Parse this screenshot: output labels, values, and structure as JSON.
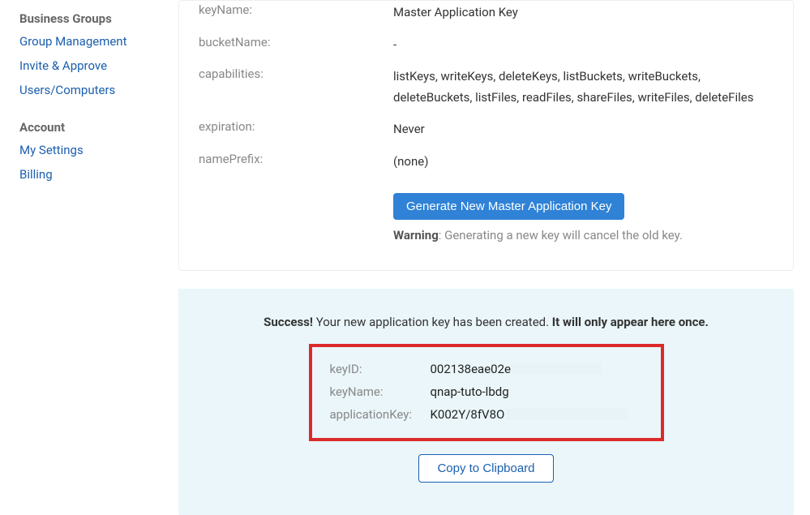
{
  "sidebar": {
    "sections": [
      {
        "title": "Business Groups",
        "items": [
          {
            "label": "Group Management"
          },
          {
            "label": "Invite & Approve"
          },
          {
            "label": "Users/Computers"
          }
        ]
      },
      {
        "title": "Account",
        "items": [
          {
            "label": "My Settings"
          },
          {
            "label": "Billing"
          }
        ]
      }
    ]
  },
  "masterKey": {
    "rows": {
      "keyName": {
        "label": "keyName:",
        "value": "Master Application Key"
      },
      "bucketName": {
        "label": "bucketName:",
        "value": "-"
      },
      "capabilities": {
        "label": "capabilities:",
        "value": "listKeys, writeKeys, deleteKeys, listBuckets, writeBuckets, deleteBuckets, listFiles, readFiles, shareFiles, writeFiles, deleteFiles"
      },
      "expiration": {
        "label": "expiration:",
        "value": "Never"
      },
      "namePrefix": {
        "label": "namePrefix:",
        "value": "(none)"
      }
    },
    "generateButton": "Generate New Master Application Key",
    "warningLabel": "Warning",
    "warningText": ": Generating a new key will cancel the old key."
  },
  "success": {
    "label": "Success!",
    "text": " Your new application key has been created. ",
    "once": "It will only appear here once.",
    "rows": {
      "keyID": {
        "label": "keyID:",
        "value": "002138eae02e"
      },
      "keyName": {
        "label": "keyName:",
        "value": "qnap-tuto-lbdg"
      },
      "applicationKey": {
        "label": "applicationKey:",
        "value": "K002Y/8fV8O"
      }
    },
    "copyButton": "Copy to Clipboard"
  }
}
